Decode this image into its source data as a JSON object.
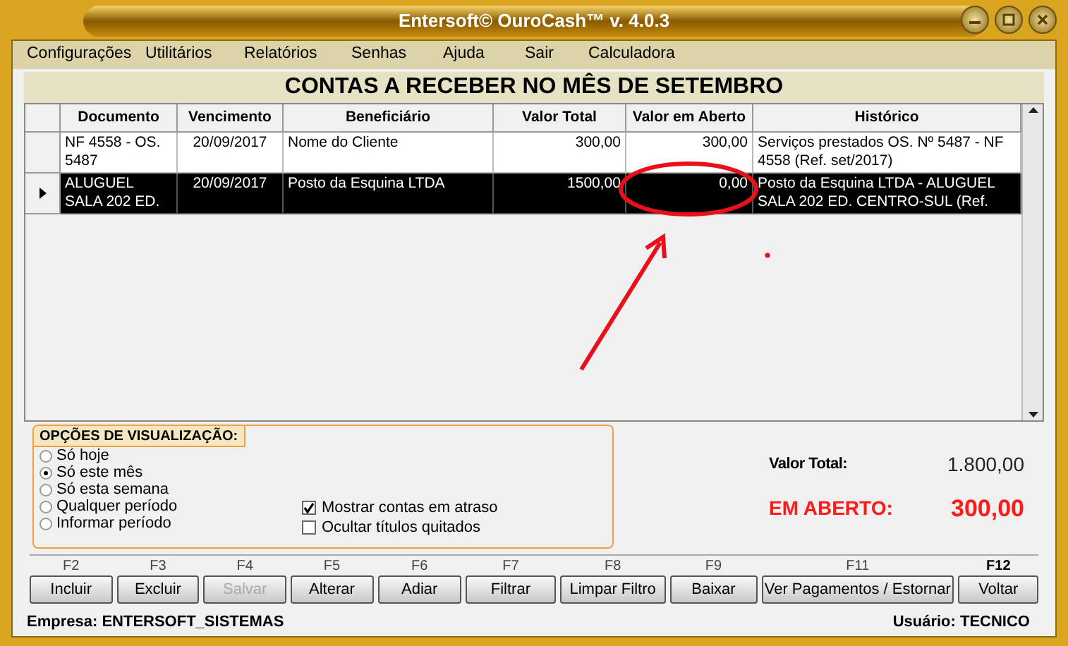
{
  "window": {
    "title": "Entersoft© OuroCash™ v. 4.0.3"
  },
  "menu": [
    "Configurações",
    "Utilitários",
    "Relatórios",
    "Senhas",
    "Ajuda",
    "Sair",
    "Calculadora"
  ],
  "heading": "CONTAS A RECEBER NO MÊS DE SETEMBRO",
  "table": {
    "columns": [
      "Documento",
      "Vencimento",
      "Beneficiário",
      "Valor Total",
      "Valor em Aberto",
      "Histórico"
    ],
    "rows": [
      {
        "selected": false,
        "cells": [
          "NF 4558 - OS. 5487",
          "20/09/2017",
          "Nome do Cliente",
          "300,00",
          "300,00",
          "Serviços prestados OS. Nº 5487 - NF 4558 (Ref. set/2017)"
        ]
      },
      {
        "selected": true,
        "cells": [
          "ALUGUEL SALA 202 ED.",
          "20/09/2017",
          "Posto da Esquina LTDA",
          "1500,00",
          "0,00",
          "Posto da Esquina LTDA - ALUGUEL SALA 202 ED. CENTRO-SUL (Ref."
        ]
      }
    ]
  },
  "options": {
    "title": "OPÇÕES DE VISUALIZAÇÃO:",
    "periods": [
      {
        "label": "Só hoje",
        "selected": false
      },
      {
        "label": "Só este mês",
        "selected": true
      },
      {
        "label": "Só esta semana",
        "selected": false
      },
      {
        "label": "Qualquer período",
        "selected": false
      },
      {
        "label": "Informar período",
        "selected": false
      }
    ],
    "checks": [
      {
        "label": "Mostrar contas em atraso",
        "checked": true
      },
      {
        "label": "Ocultar títulos quitados",
        "checked": false
      }
    ]
  },
  "totals": {
    "total_label": "Valor Total:",
    "total": "1.800,00",
    "open_label": "EM ABERTO:",
    "open": "300,00"
  },
  "buttons": [
    {
      "key": "F2",
      "label": "Incluir",
      "disabled": false,
      "default": false
    },
    {
      "key": "F3",
      "label": "Excluir",
      "disabled": false,
      "default": false
    },
    {
      "key": "F4",
      "label": "Salvar",
      "disabled": true,
      "default": false
    },
    {
      "key": "F5",
      "label": "Alterar",
      "disabled": false,
      "default": false
    },
    {
      "key": "F6",
      "label": "Adiar",
      "disabled": false,
      "default": false
    },
    {
      "key": "F7",
      "label": "Filtrar",
      "disabled": false,
      "default": false
    },
    {
      "key": "F8",
      "label": "Limpar Filtro",
      "disabled": false,
      "default": false
    },
    {
      "key": "F9",
      "label": "Baixar",
      "disabled": false,
      "default": false
    },
    {
      "key": "F11",
      "label": "Ver Pagamentos / Estornar",
      "disabled": false,
      "default": false
    },
    {
      "key": "F12",
      "label": "Voltar",
      "disabled": false,
      "default": true
    }
  ],
  "status_bar": {
    "company": "Empresa: ENTERSOFT_SISTEMAS",
    "user": "Usuário: TECNICO"
  }
}
